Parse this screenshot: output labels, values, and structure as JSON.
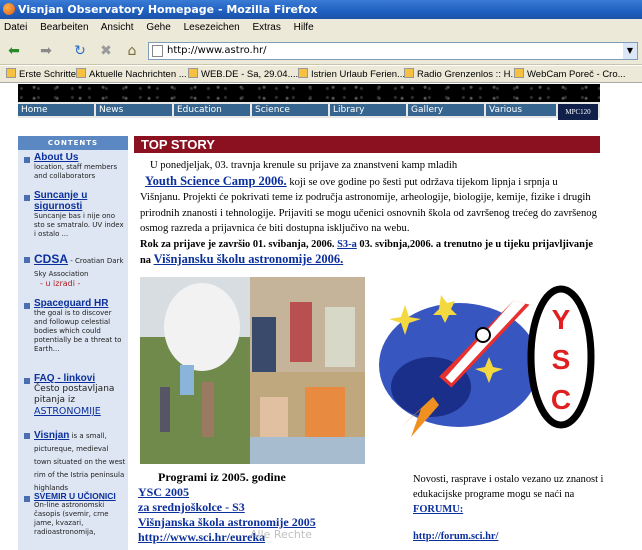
{
  "window": {
    "title": "Visnjan Observatory Homepage - Mozilla Firefox"
  },
  "menu": [
    "Datei",
    "Bearbeiten",
    "Ansicht",
    "Gehe",
    "Lesezeichen",
    "Extras",
    "Hilfe"
  ],
  "address": {
    "url": "http://www.astro.hr/"
  },
  "bookmarks": [
    "Erste Schritte",
    "Aktuelle Nachrichten ...",
    "WEB.DE - Sa, 29.04....",
    "Istrien Urlaub Ferien...",
    "Radio Grenzenlos :: H...",
    "WebCam Poreč - Cro..."
  ],
  "site_nav": [
    "Home",
    "News",
    "Education",
    "Science",
    "Library",
    "Gallery",
    "Various"
  ],
  "badge": "MPC120",
  "sidebar": {
    "header": "CONTENTS",
    "items": [
      {
        "title": "About Us",
        "desc": "location, staff members and collaborators"
      },
      {
        "title": "Suncanje u sigurnosti",
        "desc": "Suncanje bas i nije ono sto se smatralo. UV index i ostalo ..."
      },
      {
        "title": "CDSA",
        "extra": " - Croatian Dark Sky Association",
        "sub": "- u izradi -"
      },
      {
        "title": "Spaceguard HR",
        "desc": "the goal is to discover and followup celestial bodies which could potentially be a threat to Earth..."
      },
      {
        "title": "FAQ - linkovi",
        "desc": "Često postavljana pitanja iz",
        "link": "ASTRONOMIJE"
      },
      {
        "title": "Visnjan",
        "desc": " is a small, pictureque, medieval town situated on the west rim of the Istria peninsula highlands"
      },
      {
        "title": "SVEMIR U UČIONICI",
        "desc": "On-line astronomski časopis (svemir, crne jame, kvazari, radioastronomija,"
      }
    ]
  },
  "top_story": {
    "heading": "TOP STORY",
    "intro": "U ponedjeljak, 03. travnja krenule su prijave za znanstveni kamp mladih",
    "camp_link": "Youth Science Camp 2006.",
    "body": " koji se ove godine po šesti put održava tijekom lipnja i srpnja u Višnjanu. Projekti će pokrivati teme iz područja astronomije, arheologije, biologije, kemije, fizike i drugih prirodnih znanosti i tehnologije.  Prijaviti se mogu učenici osnovnih škola od završenog trećeg do završenog osmog razreda a  prijavnica će biti dostupna isključivo na webu.",
    "deadline": "Rok za prijave je završio 01. svibanja, 2006.",
    "s3_link": "S3-a",
    "deadline2": " 03. svibnja,2006. a trenutno je u tijeku prijavljivanje na ",
    "school_link": "Višnjansku školu astronomije 2006."
  },
  "logo_text": [
    "Y",
    "S",
    "C"
  ],
  "programs": {
    "title": "Programi iz 2005. godine",
    "links": [
      "YSC 2005",
      "za srednjoškolce - S3",
      "Višnjanska škola astronomije  2005",
      "http://www.sci.hr/eureka"
    ]
  },
  "forum": {
    "text": "Novosti, rasprave i ostalo vezano uz znanost i edukacijske programe mogu se naći na ",
    "link": "FORUMU:",
    "url": "http://forum.sci.hr/"
  },
  "watermark": "Alle Rechte"
}
